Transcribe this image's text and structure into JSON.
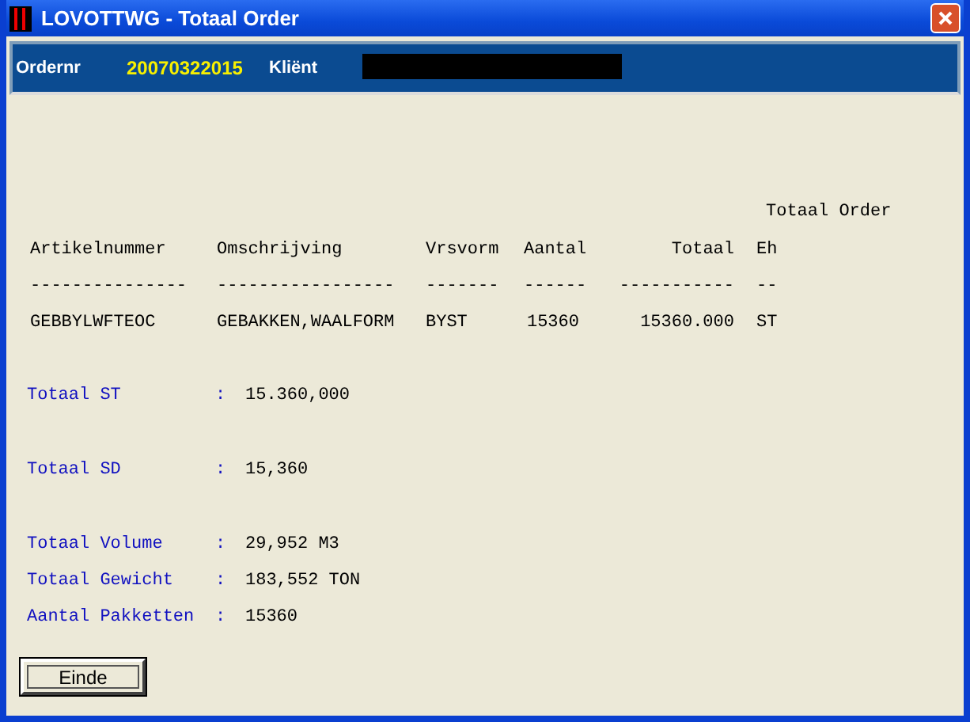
{
  "window": {
    "title": "LOVOTTWG - Totaal Order"
  },
  "header": {
    "order_label": "Ordernr",
    "order_number": "20070322015",
    "client_label": "Kliënt"
  },
  "table": {
    "caption": "Totaal Order",
    "columns": [
      {
        "label": "Artikelnummer",
        "rule": "---------------"
      },
      {
        "label": "Omschrijving",
        "rule": "-----------------"
      },
      {
        "label": "Vrsvorm",
        "rule": "-------"
      },
      {
        "label": "Aantal",
        "rule": "------"
      },
      {
        "label": "Totaal",
        "rule": "-----------"
      },
      {
        "label": "Eh",
        "rule": "--"
      }
    ],
    "rows": [
      {
        "cells": [
          "GEBBYLWFTEOC",
          "GEBAKKEN,WAALFORM",
          "BYST",
          "15360",
          "15360.000",
          "ST"
        ]
      }
    ]
  },
  "total_groups": [
    [
      {
        "label": "Totaal ST",
        "separator": ":",
        "value": "15.360,000"
      }
    ],
    [
      {
        "label": "Totaal SD",
        "separator": ":",
        "value": "15,360"
      }
    ],
    [
      {
        "label": "Totaal Volume",
        "separator": ":",
        "value": "29,952 M3"
      },
      {
        "label": "Totaal Gewicht",
        "separator": ":",
        "value": "183,552 TON"
      },
      {
        "label": "Aantal Pakketten",
        "separator": ":",
        "value": "15360"
      }
    ]
  ],
  "buttons": [
    {
      "label": "Einde"
    }
  ]
}
